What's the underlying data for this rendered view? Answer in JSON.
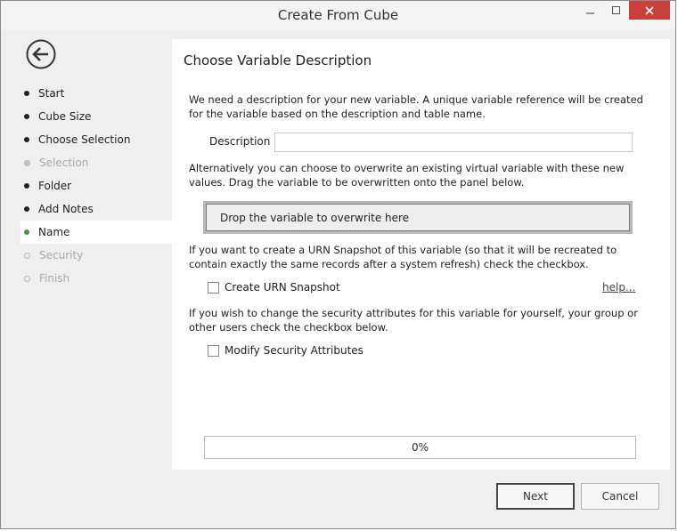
{
  "window": {
    "title": "Create From Cube"
  },
  "sidebar": {
    "items": [
      {
        "label": "Start",
        "state": "done"
      },
      {
        "label": "Cube Size",
        "state": "done"
      },
      {
        "label": "Choose Selection",
        "state": "done"
      },
      {
        "label": "Selection",
        "state": "disabled"
      },
      {
        "label": "Folder",
        "state": "done"
      },
      {
        "label": "Add Notes",
        "state": "done"
      },
      {
        "label": "Name",
        "state": "active"
      },
      {
        "label": "Security",
        "state": "pending"
      },
      {
        "label": "Finish",
        "state": "pending"
      }
    ]
  },
  "panel": {
    "title": "Choose Variable Description",
    "intro_text": "We need a description for your new variable.  A unique variable reference will be created for the variable based on the description and table name.",
    "description_label": "Description",
    "description_value": "",
    "overwrite_text": "Alternatively you can choose to overwrite an existing virtual variable with these new values. Drag the variable to be overwritten onto the panel below.",
    "drop_zone_label": "Drop the variable to overwrite here",
    "urn_text": "If you want to create a URN Snapshot of this variable (so that it will be recreated to contain exactly the same records after a system refresh) check the checkbox.",
    "urn_checkbox_label": "Create URN Snapshot",
    "help_link": "help...",
    "security_text": "If you wish to change the security attributes for this variable for yourself, your group or other users check the checkbox below.",
    "security_checkbox_label": "Modify Security Attributes",
    "progress_text": "0%",
    "progress_value": 0
  },
  "footer": {
    "next_label": "Next",
    "cancel_label": "Cancel"
  },
  "colors": {
    "close_button": "#c9403a",
    "active_bullet": "#3a9c3a"
  }
}
